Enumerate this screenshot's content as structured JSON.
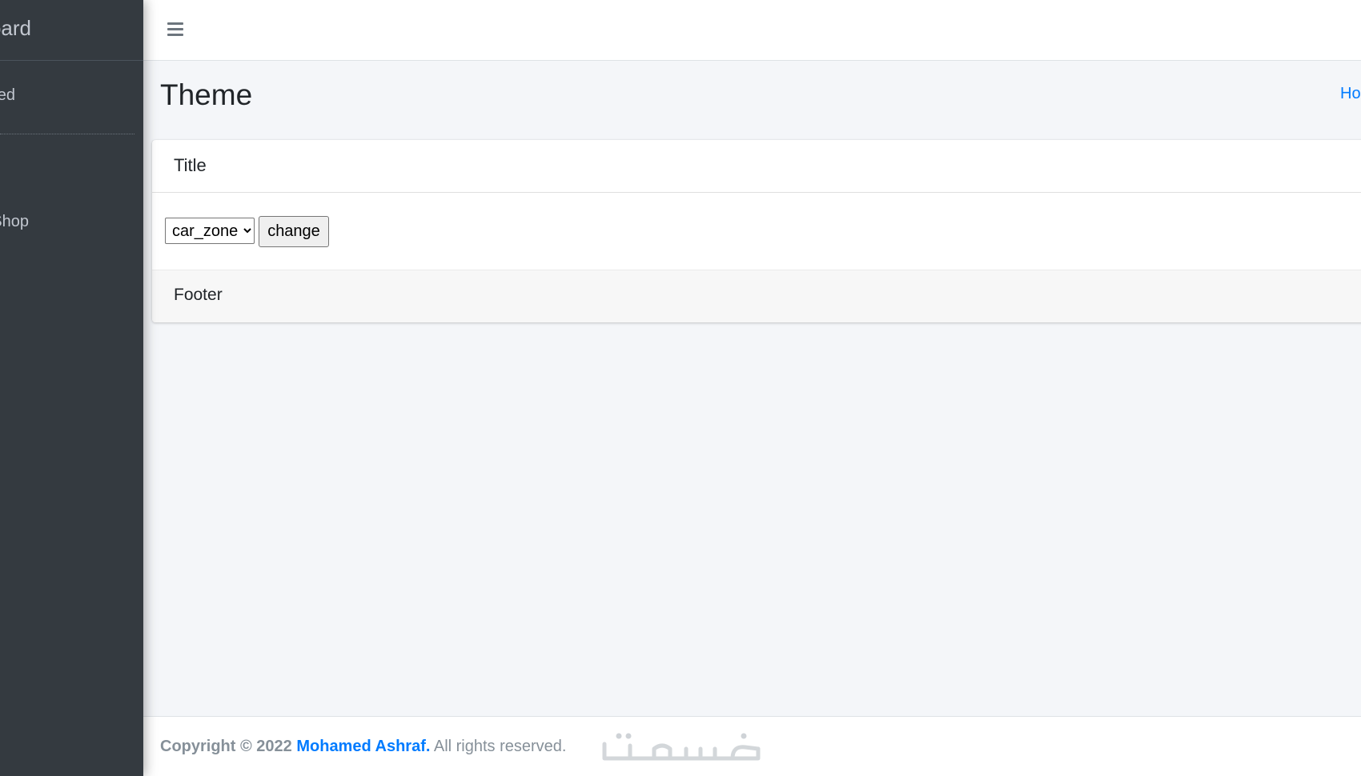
{
  "sidebar": {
    "brand_text": "AdminLTE Dashboard",
    "user_name": "Mohamed Ashraf Hamed",
    "nav_items": [
      {
        "label": "Online Shop"
      }
    ]
  },
  "navbar": {
    "menu_icon": "hamburger-icon"
  },
  "content": {
    "page_title": "Theme",
    "breadcrumb_home": "Home"
  },
  "card": {
    "title": "Title",
    "select": {
      "selected": "car_zone",
      "options": [
        "car_zone"
      ]
    },
    "change_label": "change",
    "footer": "Footer"
  },
  "footer": {
    "copyright_prefix": "Copyright © 2022 ",
    "author": "Mohamed Ashraf.",
    "suffix": " All rights reserved.",
    "watermark": "خمسات"
  },
  "colors": {
    "sidebar_bg": "#343a40",
    "accent": "#007bff",
    "content_bg": "#f4f6f9"
  }
}
